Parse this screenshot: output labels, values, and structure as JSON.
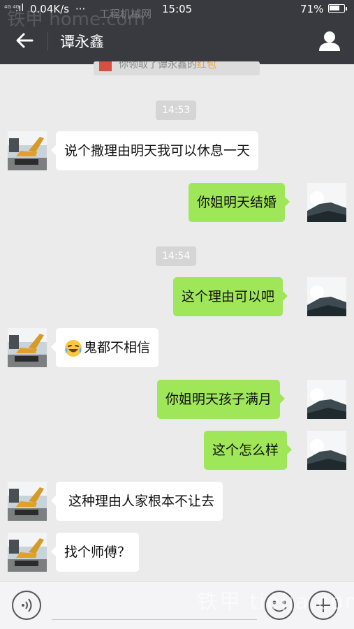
{
  "status_bar": {
    "network_type": "4G 4G",
    "speed": "0.04K/s",
    "time": "15:05",
    "battery": "71%",
    "watermark": "工程机械网",
    "watermark_brand": "铁甲 home.com"
  },
  "nav": {
    "title": "谭永鑫"
  },
  "red_packet_notice": {
    "text": "你领取了谭永鑫的",
    "link": "红包"
  },
  "timestamps": [
    "14:53",
    "14:54"
  ],
  "messages": [
    {
      "side": "in",
      "text": "说个撒理由明天我可以休息一天"
    },
    {
      "side": "out",
      "text": "你姐明天结婚"
    },
    {
      "side": "out",
      "text": "这个理由可以吧"
    },
    {
      "side": "in",
      "text": "鬼都不相信",
      "emoji": "laughing-crying-emoji"
    },
    {
      "side": "out",
      "text": "你姐明天孩子满月"
    },
    {
      "side": "out",
      "text": "这个怎么样"
    },
    {
      "side": "in",
      "text": " 这种理由人家根本不让去"
    },
    {
      "side": "in",
      "text": "找个师傅？"
    }
  ],
  "input_bar": {
    "icons": [
      "voice-icon",
      "emoji-icon",
      "plus-icon"
    ],
    "watermark": "铁甲 tiejia.com"
  },
  "colors": {
    "navbar": "#393a3f",
    "background": "#ebebeb",
    "bubble_out": "#9fe658",
    "bubble_in": "#ffffff",
    "time_badge": "#d5d5d5"
  }
}
